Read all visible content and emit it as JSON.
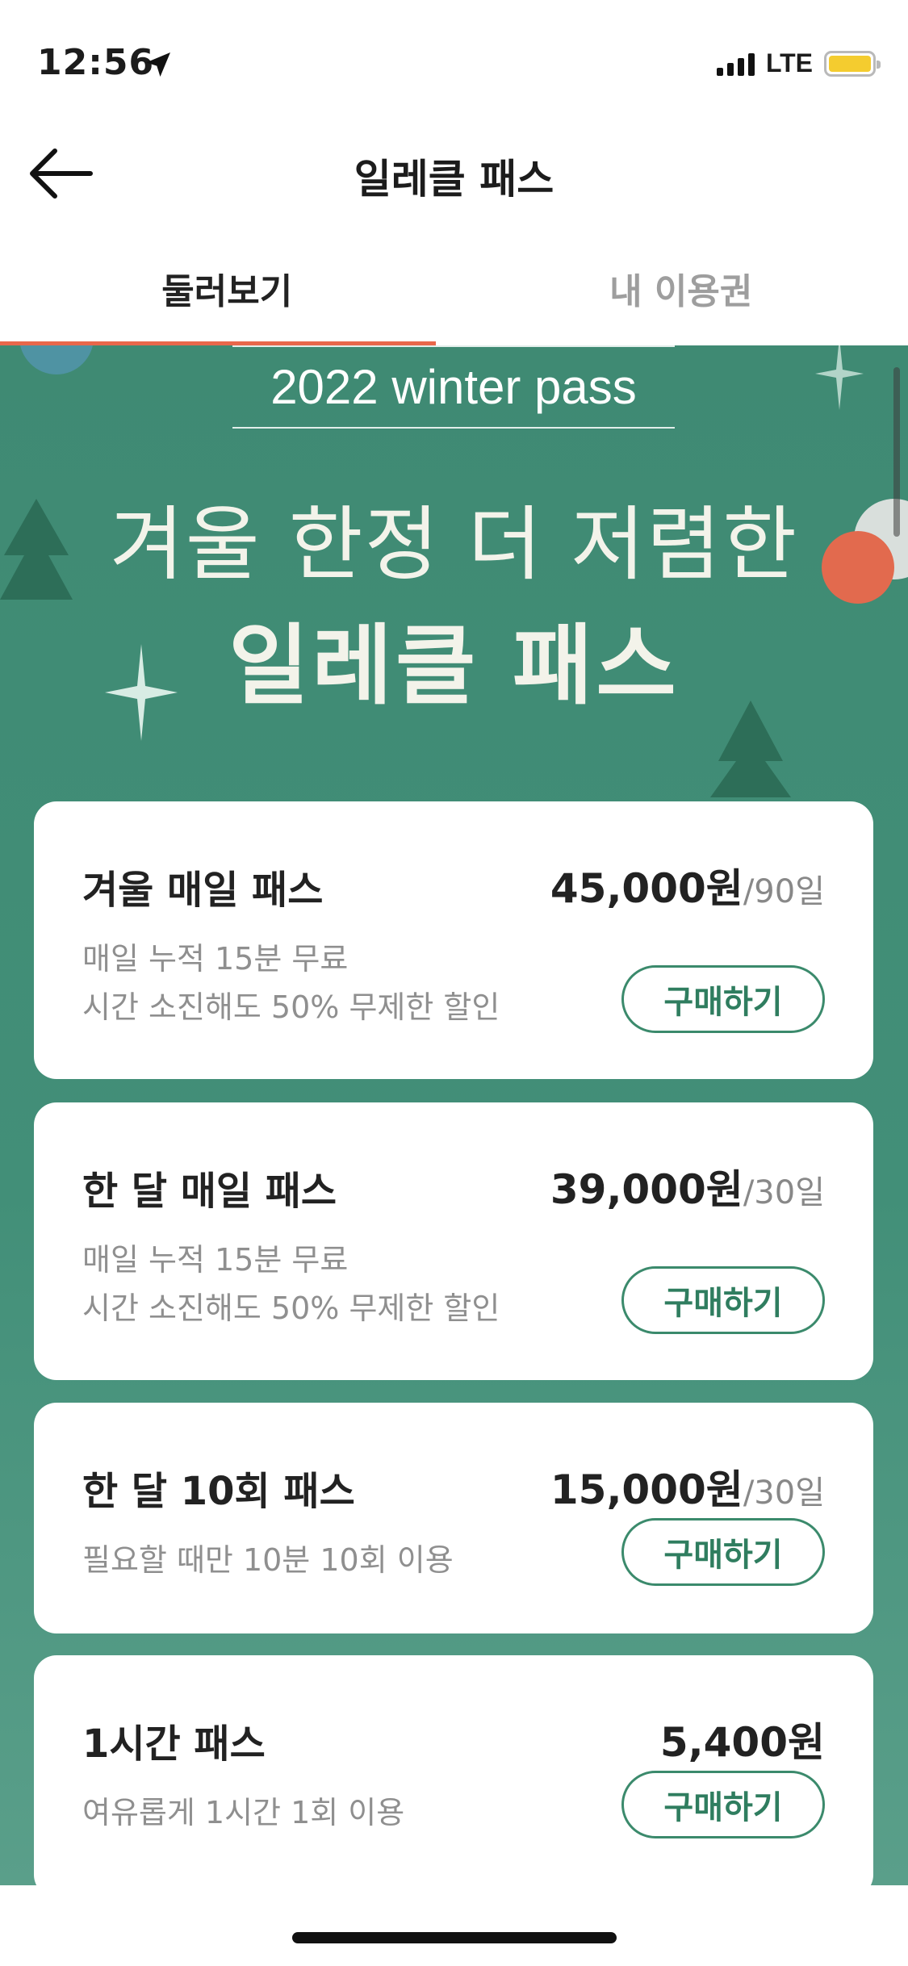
{
  "status_bar": {
    "time": "12:56",
    "network": "LTE",
    "battery_color": "#f4cc2f"
  },
  "nav": {
    "title": "일레클 패스",
    "back_icon": "back-arrow-icon"
  },
  "tabs": [
    {
      "label": "둘러보기",
      "active": true
    },
    {
      "label": "내 이용권",
      "active": false
    }
  ],
  "banner": {
    "pass_label": "2022 winter pass",
    "headline_line1": "겨울 한정 더 저렴한",
    "headline_line2": "일레클 패스",
    "background_color": "#428f78",
    "accent_color": "#e8674b"
  },
  "passes": [
    {
      "name": "겨울 매일 패스",
      "price": "45,000원",
      "period": "/90일",
      "description": [
        "매일 누적 15분 무료",
        "시간 소진해도 50% 무제한 할인"
      ],
      "button": "구매하기"
    },
    {
      "name": "한 달 매일 패스",
      "price": "39,000원",
      "period": "/30일",
      "description": [
        "매일 누적 15분 무료",
        "시간 소진해도 50% 무제한 할인"
      ],
      "button": "구매하기"
    },
    {
      "name": "한 달 10회 패스",
      "price": "15,000원",
      "period": "/30일",
      "description": [
        "필요할 때만 10분 10회 이용"
      ],
      "button": "구매하기"
    },
    {
      "name": "1시간 패스",
      "price": "5,400원",
      "period": "",
      "description": [
        "여유롭게 1시간 1회 이용"
      ],
      "button": "구매하기"
    }
  ]
}
